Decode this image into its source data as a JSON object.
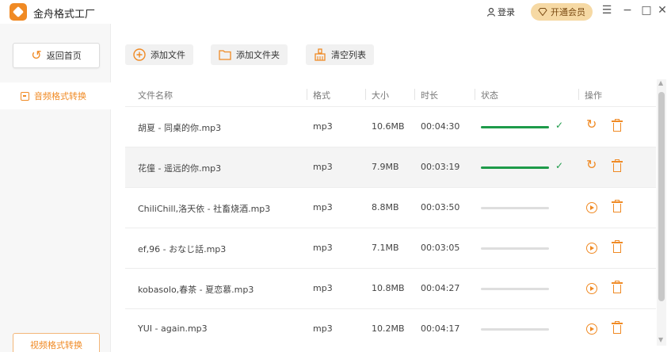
{
  "app": {
    "title": "金舟格式工厂"
  },
  "header": {
    "login_label": "登录",
    "vip_label": "开通会员",
    "menu_glyph": "☰",
    "minimize_glyph": "−",
    "maximize_glyph": "□",
    "close_glyph": "✕"
  },
  "sidebar": {
    "back_label": "返回首页",
    "audio_label": "音频格式转换",
    "video_label": "视频格式转换"
  },
  "toolbar": {
    "add_file_label": "添加文件",
    "add_folder_label": "添加文件夹",
    "clear_list_label": "清空列表"
  },
  "table": {
    "columns": [
      "文件名称",
      "格式",
      "大小",
      "时长",
      "状态",
      "操作"
    ],
    "rows": [
      {
        "name": "胡夏 - 同桌的你.mp3",
        "format": "mp3",
        "size": "10.6MB",
        "duration": "00:04:30",
        "status": "done",
        "progress": 1.0
      },
      {
        "name": "花僮 - 遥远的你.mp3",
        "format": "mp3",
        "size": "7.9MB",
        "duration": "00:03:19",
        "status": "done",
        "progress": 1.0
      },
      {
        "name": "ChiliChill,洛天依 - 社畜烧酒.mp3",
        "format": "mp3",
        "size": "8.8MB",
        "duration": "00:03:50",
        "status": "pending",
        "progress": 0
      },
      {
        "name": "ef,96 - おなじ話.mp3",
        "format": "mp3",
        "size": "7.1MB",
        "duration": "00:03:05",
        "status": "pending",
        "progress": 0
      },
      {
        "name": "kobasolo,春茶 - 夏恋慕.mp3",
        "format": "mp3",
        "size": "10.8MB",
        "duration": "00:04:27",
        "status": "pending",
        "progress": 0
      },
      {
        "name": "YUI - again.mp3",
        "format": "mp3",
        "size": "10.2MB",
        "duration": "00:04:17",
        "status": "pending",
        "progress": 0
      }
    ]
  },
  "colors": {
    "accent": "#f08a24",
    "success": "#1e9b4a",
    "vip_bg": "#f6d9a4"
  },
  "icons": {
    "logo": "app-logo-icon",
    "user": "user-icon",
    "vip": "diamond-icon",
    "back": "return-arrow-icon",
    "add_file": "plus-circle-icon",
    "add_folder": "folder-icon",
    "clear": "broom-icon",
    "done": "check-icon",
    "retry": "refresh-icon",
    "play": "play-circle-icon",
    "delete": "trash-icon"
  }
}
